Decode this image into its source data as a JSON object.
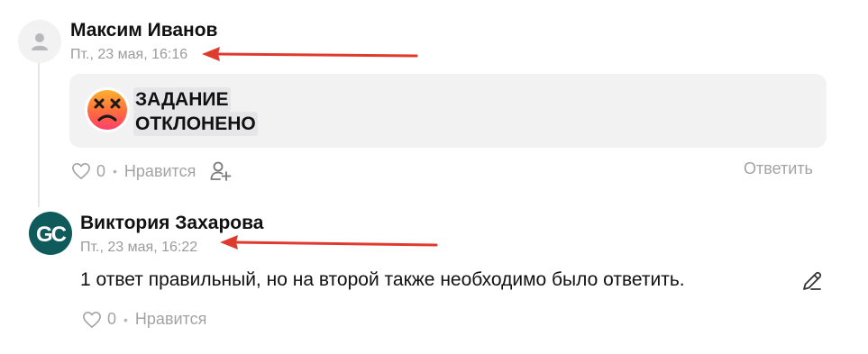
{
  "comments": [
    {
      "author": "Максим Иванов",
      "timestamp": "Пт., 23 мая, 16:16",
      "avatar_icon": "user-placeholder-icon",
      "status_card": {
        "emoji_icon": "dizzy-face-emoji-icon",
        "line1": "ЗАДАНИЕ",
        "line2": "ОТКЛОНЕНО"
      },
      "likes_count": "0",
      "like_label": "Нравится",
      "reply_label": "Ответить",
      "like_icon": "heart-icon",
      "mention_icon": "add-user-icon"
    },
    {
      "author": "Виктория Захарова",
      "timestamp": "Пт., 23 мая, 16:22",
      "avatar_text": "GC",
      "text": "1 ответ правильный, но на второй также необходимо было ответить.",
      "likes_count": "0",
      "like_label": "Нравится",
      "like_icon": "heart-icon",
      "edit_icon": "pencil-icon"
    }
  ],
  "annotations": {
    "arrow_color": "#e03a2f"
  },
  "colors": {
    "muted_text": "#9b9b9b",
    "card_bg": "#f2f2f3",
    "avatar_gc_bg": "#0f5b5c"
  }
}
